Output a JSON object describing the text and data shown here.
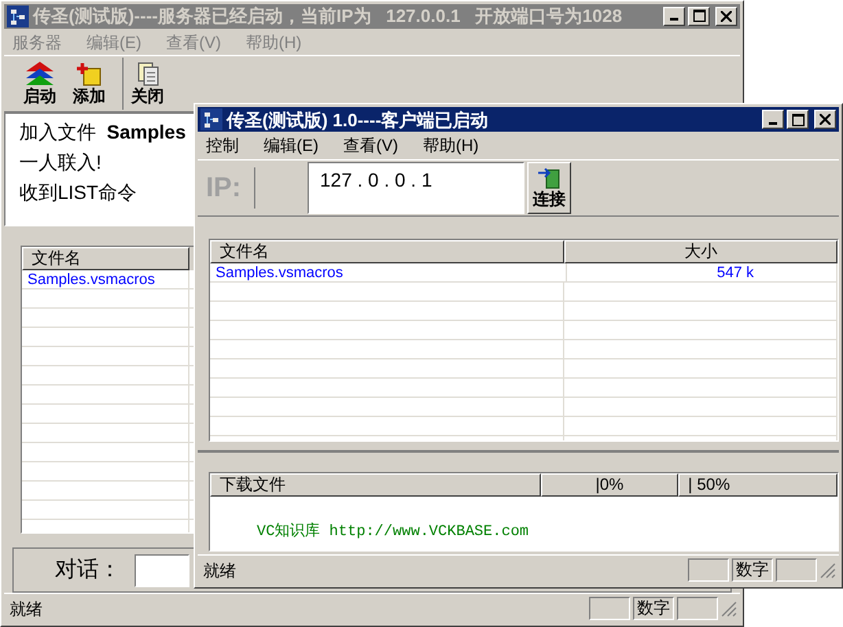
{
  "server_window": {
    "title": "传圣(测试版)----服务器已经启动，当前IP为   127.0.0.1   开放端口号为1028",
    "active": false,
    "menu": [
      "服务器",
      "编辑(E)",
      "查看(V)",
      "帮助(H)"
    ],
    "toolbar": [
      {
        "label": "启动",
        "kind": "start"
      },
      {
        "label": "添加",
        "kind": "add"
      },
      {
        "label": "关闭",
        "kind": "close"
      }
    ],
    "log": [
      "加入文件  **Samples**",
      "一人联入!",
      "收到LIST命令"
    ],
    "file_list": {
      "columns": [
        "文件名"
      ],
      "rows": [
        [
          "Samples.vsmacros"
        ]
      ]
    },
    "chat": {
      "label": "对话："
    },
    "status_bar": {
      "text": "就绪",
      "indicators": [
        "数字"
      ]
    }
  },
  "client_window": {
    "title": "传圣(测试版) 1.0----客户端已启动",
    "active": true,
    "menu": [
      "控制",
      "编辑(E)",
      "查看(V)",
      "帮助(H)"
    ],
    "ip_label": "IP:",
    "ip_field": {
      "value": "127 . 0 . 0 . 1"
    },
    "connect_button": "连接",
    "file_list": {
      "columns": [
        "文件名",
        "大小"
      ],
      "rows": [
        [
          "Samples.vsmacros",
          "547 k"
        ]
      ]
    },
    "download": {
      "columns": [
        "下载文件",
        "|0%",
        "| 50%"
      ],
      "link": "VC知识库 http://www.VCKBASE.com"
    },
    "status_bar": {
      "text": "就绪",
      "indicators": [
        "数字"
      ]
    }
  }
}
